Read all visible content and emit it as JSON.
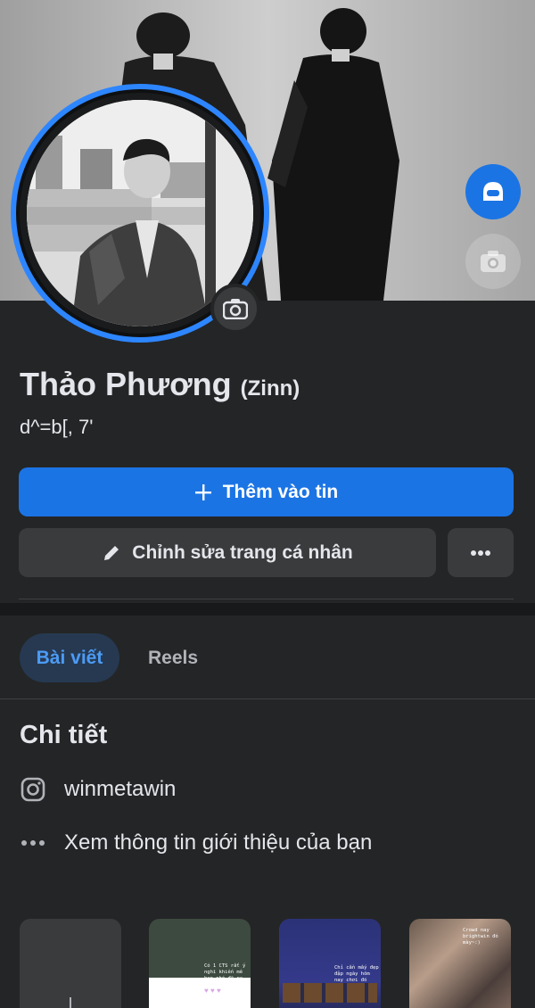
{
  "profile": {
    "name": "Thảo Phương",
    "alternate_name": "(Zinn)",
    "bio": "d^=b[, 7'"
  },
  "actions": {
    "add_story_label": "Thêm vào tin",
    "edit_profile_label": "Chỉnh sửa trang cá nhân"
  },
  "tabs": [
    {
      "label": "Bài viết",
      "active": true
    },
    {
      "label": "Reels",
      "active": false
    }
  ],
  "details": {
    "title": "Chi tiết",
    "items": [
      {
        "icon": "instagram-icon",
        "text": "winmetawin"
      },
      {
        "icon": "more-dots-icon",
        "text": "Xem thông tin giới thiệu của bạn"
      }
    ]
  },
  "featured": {
    "thumb2_text": "Có 1 CTS rất ý nghĩ khiến mê bạn nhé đã ra tết?",
    "thumb3_text": "Chỉ cần mấy đẹp đập ngày hôm nay chơi đó",
    "thumb4_text": "Crowd nay brightwin đó mày~:)"
  },
  "colors": {
    "accent": "#1b74e4",
    "ring": "#2d86ff",
    "background": "#242526",
    "button_secondary": "#3a3b3c",
    "tab_active_bg": "#263951",
    "tab_active_text": "#4c9bf5"
  }
}
